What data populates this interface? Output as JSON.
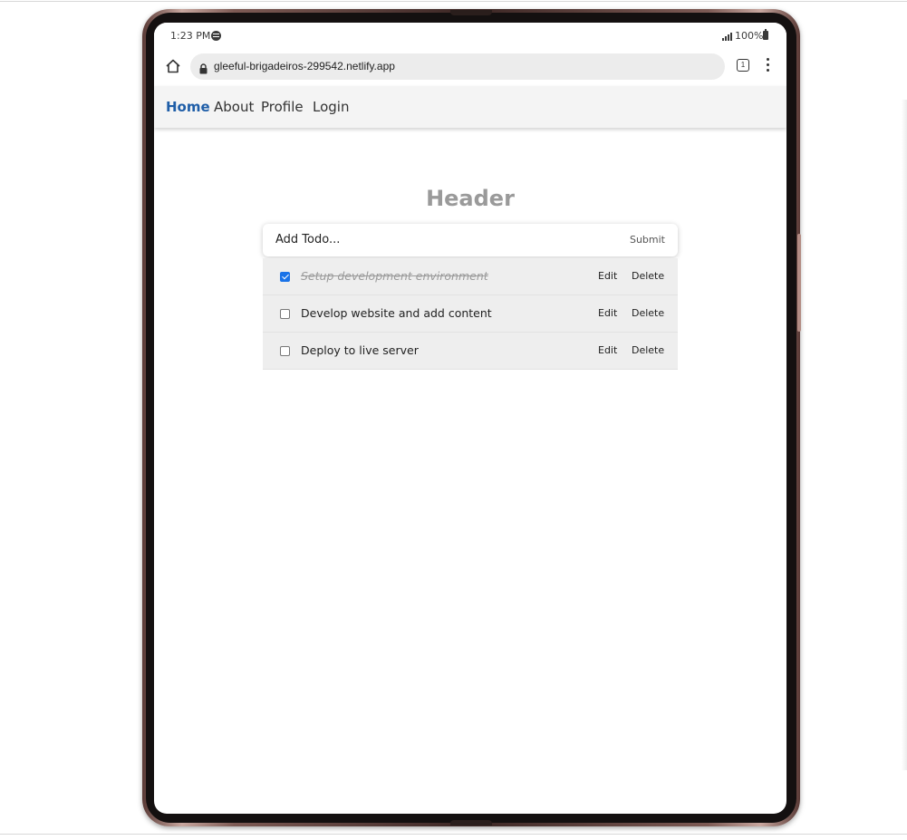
{
  "status_bar": {
    "time": "1:23 PM",
    "battery": "100%",
    "icons": [
      "spotify-icon",
      "signal-icon",
      "battery-icon"
    ]
  },
  "browser": {
    "url": "gleeful-brigadeiros-299542.netlify.app",
    "tab_count": "1",
    "icons": [
      "home-icon",
      "lock-icon",
      "tabs-icon",
      "menu-icon"
    ]
  },
  "nav": {
    "items": [
      {
        "label": "Home",
        "active": true
      },
      {
        "label": "About",
        "active": false
      },
      {
        "label": "Profile",
        "active": false
      },
      {
        "label": "Login",
        "active": false
      }
    ],
    "active_color": "#1f5ea8"
  },
  "main": {
    "header": "Header",
    "form": {
      "placeholder": "Add Todo...",
      "submit_label": "Submit"
    },
    "todos": [
      {
        "text": "Setup development environment",
        "completed": true,
        "edit_label": "Edit",
        "delete_label": "Delete"
      },
      {
        "text": "Develop website and add content",
        "completed": false,
        "edit_label": "Edit",
        "delete_label": "Delete"
      },
      {
        "text": "Deploy to live server",
        "completed": false,
        "edit_label": "Edit",
        "delete_label": "Delete"
      }
    ]
  },
  "colors": {
    "checkbox_checked": "#1a73e8",
    "header_text": "#9a9a9a",
    "row_background": "#eeeeee"
  }
}
